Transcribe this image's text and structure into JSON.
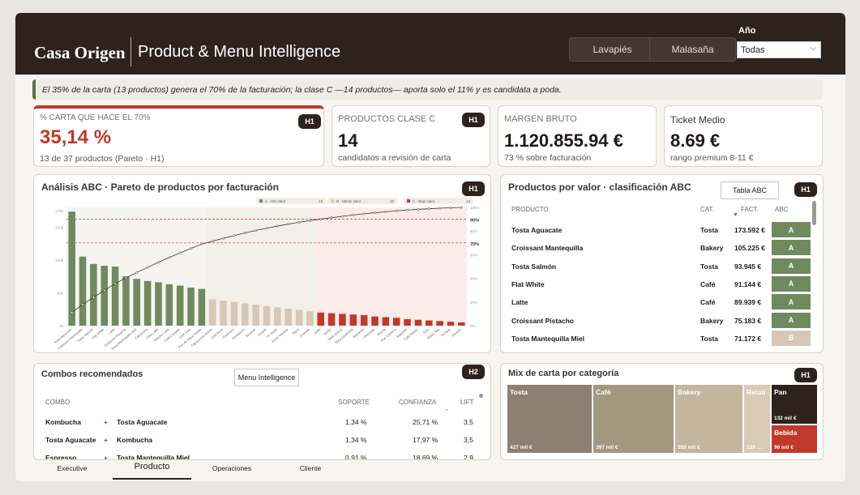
{
  "header": {
    "brand": "Casa Origen",
    "title": "Product & Menu Intelligence",
    "stores": [
      "Lavapiés",
      "Malasaña"
    ],
    "year_label": "Año",
    "year_value": "Todas"
  },
  "insight": "El 35% de la carta (13 productos) genera el 70% de la facturación; la clase C —14 productos— aporta solo el 11% y es candidata a poda.",
  "kpis": [
    {
      "label": "% CARTA QUE HACE EL 70%",
      "value": "35,14 %",
      "sub": "13 de 37 productos (Pareto · H1)",
      "badge": "H1"
    },
    {
      "label": "PRODUCTOS CLASE C",
      "value": "14",
      "sub": "candidatos a revisión de carta",
      "badge": "H1"
    },
    {
      "label": "MARGEN BRUTO",
      "value": "1.120.855.94 €",
      "sub": "73 % sobre facturación",
      "badge": ""
    },
    {
      "label": "Ticket Medio",
      "value": "8.69 €",
      "sub": "rango premium 8-11 €",
      "badge": ""
    }
  ],
  "pareto": {
    "title": "Análisis ABC · Pareto de productos por facturación",
    "badge": "H1",
    "legend": [
      {
        "label": "A · Alto valor",
        "count": "13"
      },
      {
        "label": "B · Medio valor",
        "count": "10"
      },
      {
        "label": "C · Bajo valor",
        "count": "14"
      }
    ],
    "ref_labels": [
      "90%",
      "70%"
    ],
    "y_ticks": [
      "175k",
      "150k",
      "100k",
      "50k",
      "0k"
    ],
    "r_ticks": [
      "100%",
      "80%",
      "60%",
      "40%",
      "20%",
      "0%"
    ]
  },
  "chart_data": {
    "type": "bar",
    "title": "Análisis ABC · Pareto de productos por facturación",
    "categories": [
      "Tosta Aguacate",
      "Croissant Mantequilla",
      "Tosta Salmón",
      "Flat White",
      "Latte",
      "Croissant Pistacho",
      "Tosta Mantequilla Miel",
      "Capuccino",
      "Chai Latte",
      "Matcha Latte",
      "Café Cortado",
      "Café Solo",
      "Pan de Masa Madre",
      "Cappuccino Avena",
      "Cold Brew",
      "Espresso",
      "Kombucha",
      "Brownie",
      "Cookie",
      "Té Verde",
      "Zumo Naranja",
      "Agua",
      "Granola",
      "Bollo",
      "Muffin",
      "Tarta Queso",
      "Tarta Zanahoria",
      "Bizcocho",
      "Limonada",
      "Mocha",
      "Pan Centeno",
      "Baguette",
      "Café Molido",
      "Taza",
      "Bolsa Tela",
      "Té Rojo",
      "Infusión"
    ],
    "values": [
      173592,
      105225,
      93945,
      91144,
      89939,
      75183,
      71172,
      68000,
      66000,
      63000,
      61000,
      58000,
      56000,
      40000,
      38000,
      36000,
      34000,
      32000,
      30000,
      28000,
      26000,
      24000,
      22000,
      20000,
      19000,
      18000,
      17000,
      16000,
      14000,
      13000,
      12000,
      10000,
      9000,
      8000,
      7000,
      6000,
      5000
    ],
    "classes": [
      "A",
      "A",
      "A",
      "A",
      "A",
      "A",
      "A",
      "A",
      "A",
      "A",
      "A",
      "A",
      "A",
      "B",
      "B",
      "B",
      "B",
      "B",
      "B",
      "B",
      "B",
      "B",
      "B",
      "C",
      "C",
      "C",
      "C",
      "C",
      "C",
      "C",
      "C",
      "C",
      "C",
      "C",
      "C",
      "C",
      "C"
    ],
    "ylim": [
      0,
      180000
    ],
    "reference_lines": [
      0.9,
      0.7
    ]
  },
  "products_table": {
    "title": "Productos por valor · clasificación ABC",
    "button": "Tabla ABC",
    "badge": "H1",
    "headers": [
      "PRODUCTO",
      "CAT.",
      "FACT.",
      "ABC"
    ],
    "rows": [
      {
        "product": "Tosta Aguacate",
        "cat": "Tosta",
        "fact": "173.592 €",
        "abc": "A"
      },
      {
        "product": "Croissant Mantequilla",
        "cat": "Bakery",
        "fact": "105.225 €",
        "abc": "A"
      },
      {
        "product": "Tosta Salmón",
        "cat": "Tosta",
        "fact": "93.945 €",
        "abc": "A"
      },
      {
        "product": "Flat White",
        "cat": "Café",
        "fact": "91.144 €",
        "abc": "A"
      },
      {
        "product": "Latte",
        "cat": "Café",
        "fact": "89.939 €",
        "abc": "A"
      },
      {
        "product": "Croissant Pistacho",
        "cat": "Bakery",
        "fact": "75.183 €",
        "abc": "A"
      },
      {
        "product": "Tosta Mantequilla Miel",
        "cat": "Tosta",
        "fact": "71.172 €",
        "abc": "B"
      }
    ]
  },
  "combos": {
    "title": "Combos recomendados",
    "button": "Menu Intelligence",
    "badge": "H2",
    "headers": [
      "COMBO",
      "SOPORTE",
      "CONFIANZA",
      "LIFT"
    ],
    "rows": [
      {
        "a": "Kombucha",
        "b": "Tosta Aguacate",
        "soporte": "1,34 %",
        "confianza": "25,71 %",
        "lift": "3,5"
      },
      {
        "a": "Tosta Aguacate",
        "b": "Kombucha",
        "soporte": "1,34 %",
        "confianza": "17,97 %",
        "lift": "3,5"
      },
      {
        "a": "Espresso",
        "b": "Tosta Mantequilla Miel",
        "soporte": "0,91 %",
        "confianza": "18,69 %",
        "lift": "2,9"
      }
    ]
  },
  "mix": {
    "title": "Mix de carta por categoría",
    "badge": "H1",
    "tiles": [
      {
        "label": "Tosta",
        "value": "427 mil €",
        "color": "#8b8071"
      },
      {
        "label": "Café",
        "value": "397 mil €",
        "color": "#a3977f"
      },
      {
        "label": "Bakery",
        "value": "350 mil €",
        "color": "#c3b59e"
      },
      {
        "label": "Retail",
        "value": "139 ...",
        "color": "#d8cab5"
      },
      {
        "label": "Pan",
        "value": "132 mil €",
        "color": "#2e221d"
      },
      {
        "label": "Bebida",
        "value": "96 mil €",
        "color": "#c0392b"
      }
    ]
  },
  "nav": {
    "tabs": [
      "Executive",
      "Producto",
      "Operaciones",
      "Cliente"
    ],
    "active": "Producto"
  },
  "colors": {
    "A": "#6f8a5f",
    "B": "#d6c8b4",
    "C": "#c0392b",
    "accent": "#c0392b",
    "header": "#2e221d"
  }
}
